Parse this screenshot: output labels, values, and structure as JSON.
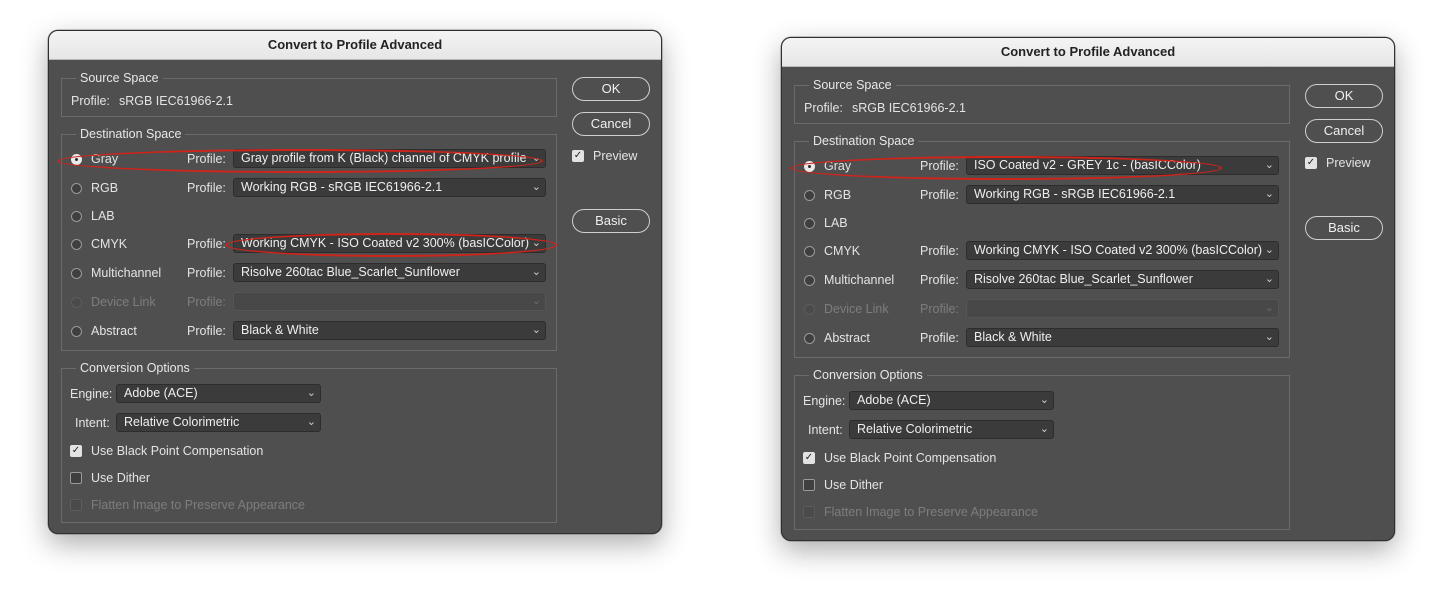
{
  "dialogs": [
    {
      "title": "Convert to Profile Advanced",
      "source": {
        "legend": "Source Space",
        "profile_label": "Profile:",
        "profile_value": "sRGB IEC61966-2.1"
      },
      "destination": {
        "legend": "Destination Space",
        "selected": "Gray",
        "rows": [
          {
            "label": "Gray",
            "profile_label": "Profile:",
            "profile": "Gray profile from K (Black) channel of CMYK profile",
            "checked": true,
            "enabled": true
          },
          {
            "label": "RGB",
            "profile_label": "Profile:",
            "profile": "Working RGB - sRGB IEC61966-2.1",
            "checked": false,
            "enabled": true
          },
          {
            "label": "LAB",
            "profile_label": "",
            "profile": null,
            "checked": false,
            "enabled": true
          },
          {
            "label": "CMYK",
            "profile_label": "Profile:",
            "profile": "Working CMYK - ISO Coated v2 300% (basICColor)",
            "checked": false,
            "enabled": true
          },
          {
            "label": "Multichannel",
            "profile_label": "Profile:",
            "profile": "Risolve 260tac Blue_Scarlet_Sunflower",
            "checked": false,
            "enabled": true
          },
          {
            "label": "Device Link",
            "profile_label": "Profile:",
            "profile": "",
            "checked": false,
            "enabled": false
          },
          {
            "label": "Abstract",
            "profile_label": "Profile:",
            "profile": "Black & White",
            "checked": false,
            "enabled": true
          }
        ]
      },
      "conversion": {
        "legend": "Conversion Options",
        "engine_label": "Engine:",
        "engine": "Adobe (ACE)",
        "intent_label": "Intent:",
        "intent": "Relative Colorimetric",
        "options": [
          {
            "label": "Use Black Point Compensation",
            "checked": true,
            "enabled": true
          },
          {
            "label": "Use Dither",
            "checked": false,
            "enabled": true
          },
          {
            "label": "Flatten Image to Preserve Appearance",
            "checked": false,
            "enabled": false
          }
        ]
      },
      "buttons": {
        "ok": "OK",
        "cancel": "Cancel",
        "basic": "Basic"
      },
      "preview": {
        "label": "Preview",
        "checked": true
      },
      "highlights": [
        "Gray",
        "CMYK"
      ]
    },
    {
      "title": "Convert to Profile Advanced",
      "source": {
        "legend": "Source Space",
        "profile_label": "Profile:",
        "profile_value": "sRGB IEC61966-2.1"
      },
      "destination": {
        "legend": "Destination Space",
        "selected": "Gray",
        "rows": [
          {
            "label": "Gray",
            "profile_label": "Profile:",
            "profile": "ISO Coated v2 - GREY 1c - (basICColor)",
            "checked": true,
            "enabled": true
          },
          {
            "label": "RGB",
            "profile_label": "Profile:",
            "profile": "Working RGB - sRGB IEC61966-2.1",
            "checked": false,
            "enabled": true
          },
          {
            "label": "LAB",
            "profile_label": "",
            "profile": null,
            "checked": false,
            "enabled": true
          },
          {
            "label": "CMYK",
            "profile_label": "Profile:",
            "profile": "Working CMYK - ISO Coated v2 300% (basICColor)",
            "checked": false,
            "enabled": true
          },
          {
            "label": "Multichannel",
            "profile_label": "Profile:",
            "profile": "Risolve 260tac Blue_Scarlet_Sunflower",
            "checked": false,
            "enabled": true
          },
          {
            "label": "Device Link",
            "profile_label": "Profile:",
            "profile": "",
            "checked": false,
            "enabled": false
          },
          {
            "label": "Abstract",
            "profile_label": "Profile:",
            "profile": "Black & White",
            "checked": false,
            "enabled": true
          }
        ]
      },
      "conversion": {
        "legend": "Conversion Options",
        "engine_label": "Engine:",
        "engine": "Adobe (ACE)",
        "intent_label": "Intent:",
        "intent": "Relative Colorimetric",
        "options": [
          {
            "label": "Use Black Point Compensation",
            "checked": true,
            "enabled": true
          },
          {
            "label": "Use Dither",
            "checked": false,
            "enabled": true
          },
          {
            "label": "Flatten Image to Preserve Appearance",
            "checked": false,
            "enabled": false
          }
        ]
      },
      "buttons": {
        "ok": "OK",
        "cancel": "Cancel",
        "basic": "Basic"
      },
      "preview": {
        "label": "Preview",
        "checked": true
      },
      "highlights": [
        "Gray"
      ]
    }
  ],
  "colors": {
    "dialog_bg": "#4f4f4f",
    "titlebar_bg": "#ececec",
    "highlight": "#d0241b",
    "page_bg": "#ffffff"
  },
  "icons": {
    "dropdown": "chevron-down-icon",
    "checkmark": "checkmark-icon"
  }
}
